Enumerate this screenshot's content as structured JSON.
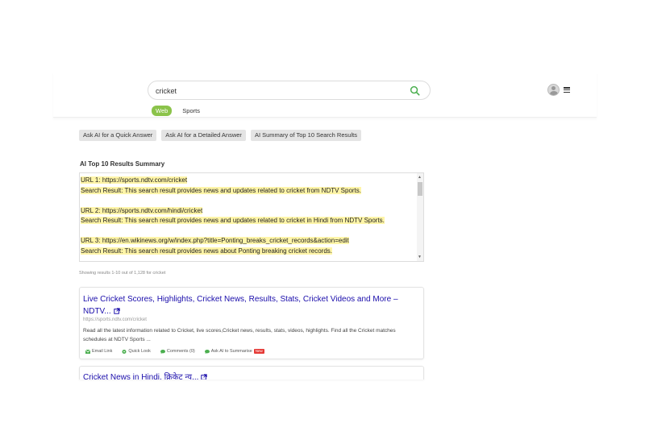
{
  "search": {
    "value": "cricket",
    "placeholder": "Search"
  },
  "tabs": [
    {
      "label": "Web",
      "active": true
    },
    {
      "label": "Sports",
      "active": false
    }
  ],
  "ai_buttons": [
    "Ask AI for a Quick Answer",
    "Ask AI for a Detailed Answer",
    "AI Summary of Top 10 Search Results"
  ],
  "summary": {
    "title": "AI Top 10 Results Summary",
    "items": [
      {
        "url_line": "URL 1: https://sports.ndtv.com/cricket",
        "result_line": "Search Result: This search result provides news and updates related to cricket from NDTV Sports."
      },
      {
        "url_line": "URL 2: https://sports.ndtv.com/hindi/cricket",
        "result_line": "Search Result: This search result provides news and updates related to cricket in Hindi from NDTV Sports."
      },
      {
        "url_line": "URL 3: https://en.wikinews.org/w/index.php?title=Ponting_breaks_cricket_records&action=edit",
        "result_line": "Search Result: This search result provides news about Ponting breaking cricket records."
      }
    ]
  },
  "results_info": "Showing results 1-10 out of 1,128 for cricket",
  "results": [
    {
      "title": "Live Cricket Scores, Highlights, Cricket News, Results, Stats, Cricket Videos and More – NDTV...",
      "url": "https://sports.ndtv.com/cricket",
      "snippet": "Read all the latest information related to Cricket, live scores,Cricket news, results, stats, videos, highlights. Find all the Cricket matches schedules at NDTV Sports ...",
      "actions": {
        "email": "Email Link",
        "quick_look": "Quick Look",
        "comments": "Comments (0)",
        "ask_ai": "Ask AI to Summarise",
        "new_badge": "New"
      }
    },
    {
      "title": "Cricket News in Hindi, क्रिकेट न्यू..."
    }
  ],
  "colors": {
    "accent_green": "#8bc34a",
    "link_blue": "#1a0dab",
    "highlight_yellow": "#fff5a8",
    "new_badge_red": "#e53935"
  },
  "icons": [
    "search-icon",
    "avatar",
    "menu-icon",
    "external-link-icon",
    "email-icon",
    "quick-look-icon",
    "comments-icon",
    "ask-ai-icon"
  ]
}
